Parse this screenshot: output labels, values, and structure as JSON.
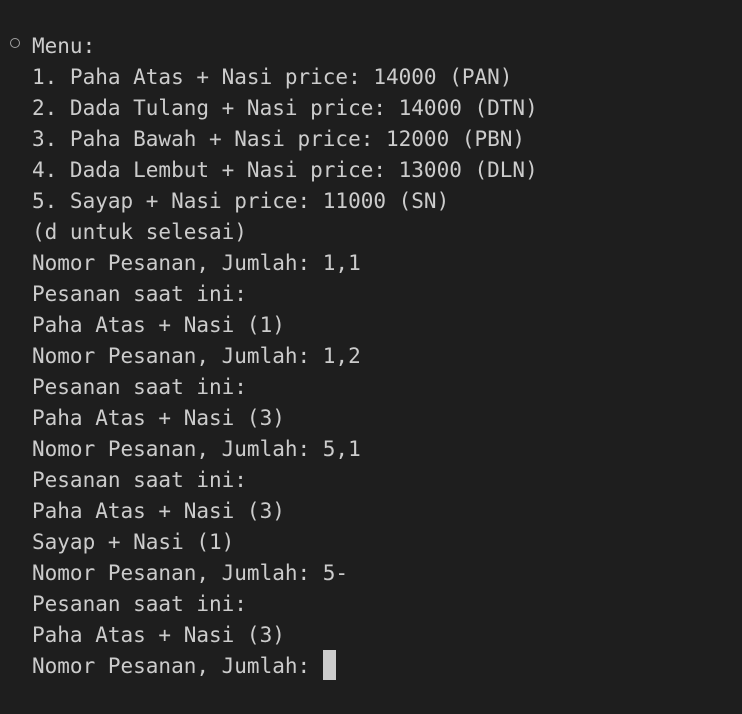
{
  "terminal": {
    "lines": [
      "Menu:",
      "1. Paha Atas + Nasi price: 14000 (PAN)",
      "2. Dada Tulang + Nasi price: 14000 (DTN)",
      "3. Paha Bawah + Nasi price: 12000 (PBN)",
      "4. Dada Lembut + Nasi price: 13000 (DLN)",
      "5. Sayap + Nasi price: 11000 (SN)",
      "(d untuk selesai)",
      "Nomor Pesanan, Jumlah: 1,1",
      "Pesanan saat ini:",
      "Paha Atas + Nasi (1)",
      "Nomor Pesanan, Jumlah: 1,2",
      "Pesanan saat ini:",
      "Paha Atas + Nasi (3)",
      "Nomor Pesanan, Jumlah: 5,1",
      "Pesanan saat ini:",
      "Paha Atas + Nasi (3)",
      "Sayap + Nasi (1)",
      "Nomor Pesanan, Jumlah: 5-",
      "Pesanan saat ini:",
      "Paha Atas + Nasi (3)"
    ],
    "prompt": "Nomor Pesanan, Jumlah: ",
    "colors": {
      "background": "#1e1e1e",
      "text": "#cccccc",
      "cursor": "#cccccc"
    }
  }
}
